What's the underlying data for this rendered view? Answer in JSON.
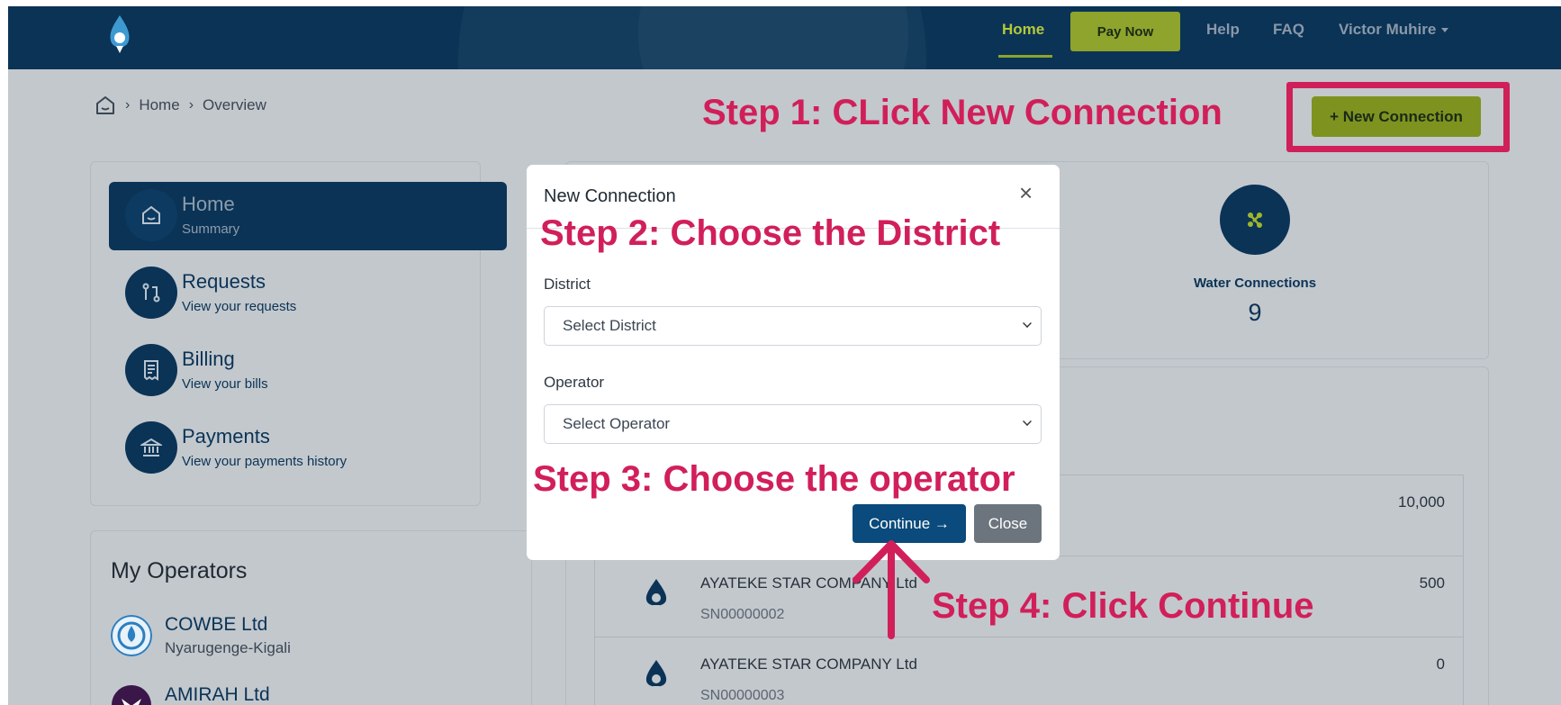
{
  "nav": {
    "home": "Home",
    "pay_now": "Pay Now",
    "help": "Help",
    "faq": "FAQ",
    "user": "Victor Muhire"
  },
  "breadcrumb": {
    "home": "Home",
    "current": "Overview"
  },
  "actions": {
    "new_connection": "+ New Connection"
  },
  "sidebar": {
    "items": [
      {
        "title": "Home",
        "subtitle": "Summary",
        "icon": "home-icon"
      },
      {
        "title": "Requests",
        "subtitle": "View your requests",
        "icon": "requests-icon"
      },
      {
        "title": "Billing",
        "subtitle": "View your bills",
        "icon": "receipt-icon"
      },
      {
        "title": "Payments",
        "subtitle": "View your payments history",
        "icon": "bank-icon"
      }
    ]
  },
  "operators": {
    "title": "My Operators",
    "items": [
      {
        "name": "COWBE Ltd",
        "location": "Nyarugenge-Kigali"
      },
      {
        "name": "AMIRAH Ltd",
        "location": ""
      }
    ]
  },
  "stats": {
    "water_connections_label": "Water Connections",
    "water_connections_count": "9"
  },
  "connections": [
    {
      "name": "",
      "sn": "",
      "amount": "10,000"
    },
    {
      "name": "AYATEKE STAR COMPANY Ltd",
      "sn": "SN00000002",
      "amount": "500"
    },
    {
      "name": "AYATEKE STAR COMPANY Ltd",
      "sn": "SN00000003",
      "amount": "0"
    }
  ],
  "modal": {
    "title": "New Connection",
    "district_label": "District",
    "district_value": "Select District",
    "operator_label": "Operator",
    "operator_value": "Select Operator",
    "continue": "Continue →",
    "close": "Close"
  },
  "annotations": {
    "step1": "Step 1: CLick New Connection",
    "step2": "Step 2: Choose the District",
    "step3": "Step 3: Choose the operator",
    "step4": "Step 4: Click Continue"
  },
  "colors": {
    "navy": "#0a3356",
    "accent_green": "#8ea42c",
    "annotation": "#d11f59"
  }
}
